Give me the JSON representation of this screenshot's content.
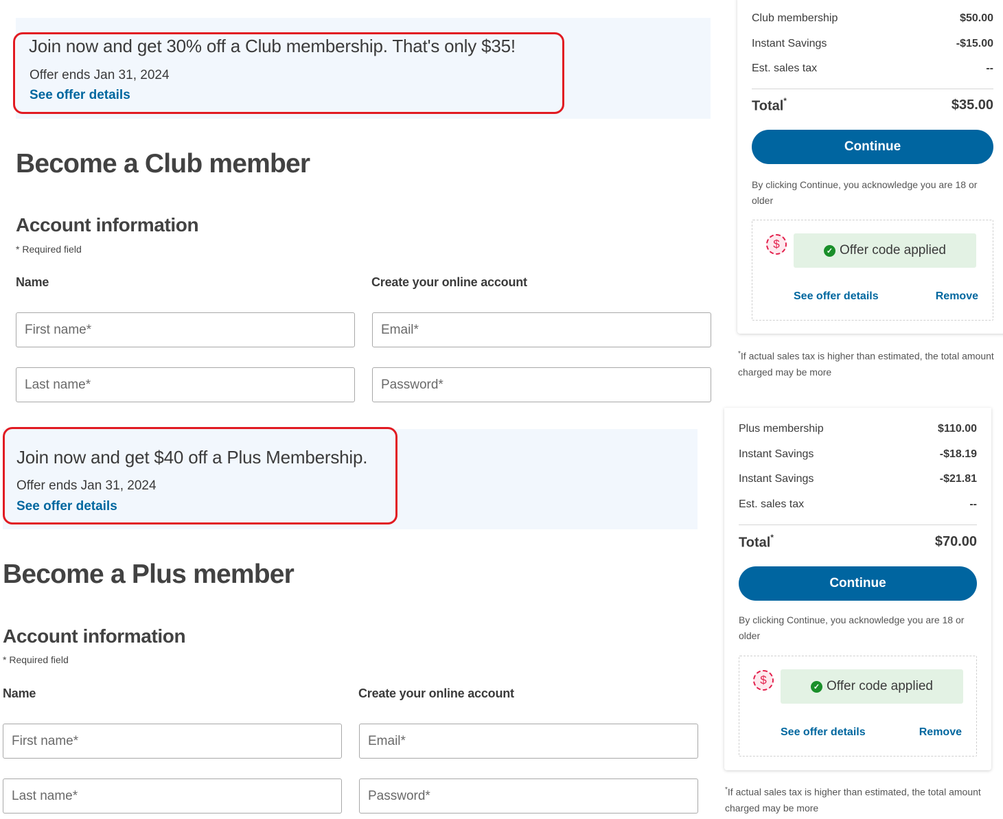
{
  "sections": [
    {
      "offer": {
        "title": "Join now and get 30% off a Club membership. That's only $35!",
        "ends": "Offer ends Jan 31, 2024",
        "link": "See offer details"
      },
      "page_title": "Become a Club member",
      "account_title": "Account information",
      "required_note": "* Required field",
      "name_label": "Name",
      "account_label": "Create your online account",
      "fields": {
        "first_name": "First name*",
        "last_name": "Last name*",
        "email": "Email*",
        "password": "Password*"
      },
      "summary": {
        "rows": [
          {
            "label": "Club membership",
            "value": "$50.00"
          },
          {
            "label": "Instant Savings",
            "value": "-$15.00"
          },
          {
            "label": "Est. sales tax",
            "value": "--"
          }
        ],
        "total_label": "Total",
        "total_mark": "*",
        "total_value": "$35.00",
        "continue_label": "Continue",
        "ack": "By clicking Continue, you acknowledge you are 18 or older",
        "offer_applied": "Offer code applied",
        "offer_details_link": "See offer details",
        "remove_link": "Remove",
        "tax_note_mark": "*",
        "tax_note": "If actual sales tax is higher than estimated, the total amount charged may be more"
      }
    },
    {
      "offer": {
        "title": "Join now and get $40 off a Plus Membership.",
        "ends": "Offer ends Jan 31, 2024",
        "link": "See offer details"
      },
      "page_title": "Become a Plus member",
      "account_title": "Account information",
      "required_note": "* Required field",
      "name_label": "Name",
      "account_label": "Create your online account",
      "fields": {
        "first_name": "First name*",
        "last_name": "Last name*",
        "email": "Email*",
        "password": "Password*"
      },
      "summary": {
        "rows": [
          {
            "label": "Plus membership",
            "value": "$110.00"
          },
          {
            "label": "Instant Savings",
            "value": "-$18.19"
          },
          {
            "label": "Instant Savings",
            "value": "-$21.81"
          },
          {
            "label": "Est. sales tax",
            "value": "--"
          }
        ],
        "total_label": "Total",
        "total_mark": "*",
        "total_value": "$70.00",
        "continue_label": "Continue",
        "ack": "By clicking Continue, you acknowledge you are 18 or older",
        "offer_applied": "Offer code applied",
        "offer_details_link": "See offer details",
        "remove_link": "Remove",
        "tax_note_mark": "*",
        "tax_note": "If actual sales tax is higher than estimated, the total amount charged may be more"
      }
    }
  ],
  "icons": {
    "dollar": "$",
    "check": "✓"
  },
  "colors": {
    "link": "#00679f",
    "primary_button": "#0065a0",
    "highlight_border": "#e11b22",
    "offer_banner_bg": "#f2f7fd",
    "applied_bg": "#e3f2e4",
    "check_green": "#1a8f2a",
    "dollar_red": "#e3204c"
  }
}
